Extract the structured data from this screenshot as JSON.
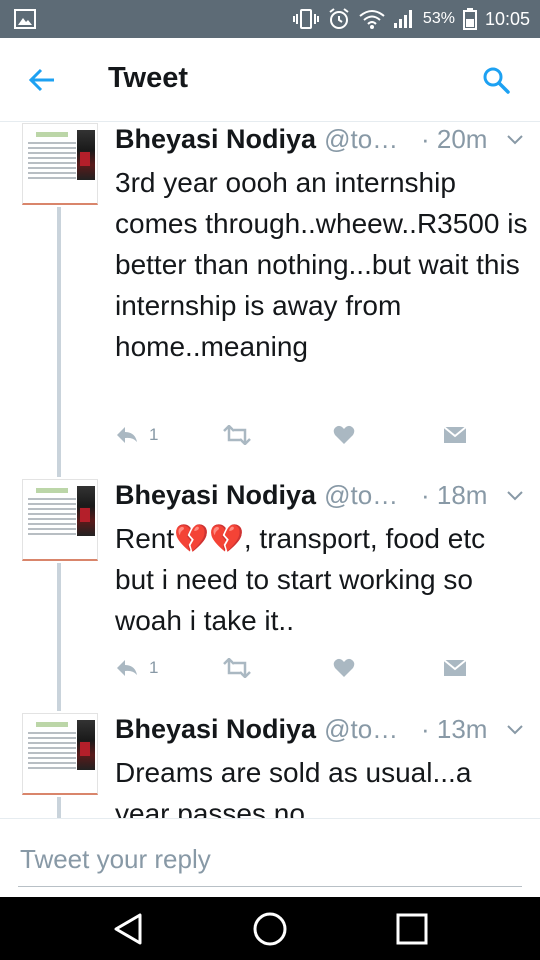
{
  "status_bar": {
    "battery_percent": "53%",
    "time": "10:05",
    "icons": [
      "gallery-icon",
      "vibrate-icon",
      "alarm-icon",
      "wifi-icon",
      "signal-icon",
      "battery-icon"
    ]
  },
  "app_bar": {
    "title": "Tweet",
    "back_icon": "arrow-left-icon",
    "search_icon": "search-icon",
    "accent_color": "#1da1f2"
  },
  "tweets": [
    {
      "name": "Bheyasi Nodiya",
      "handle": "@to…",
      "time": "· 20m",
      "text": "3rd year oooh an internship comes through..wheew..R3500 is better than nothing...but wait this internship is away from home..meaning",
      "reply_count": "1",
      "retweet_count": "",
      "like_count": ""
    },
    {
      "name": "Bheyasi Nodiya",
      "handle": "@to…",
      "time": "· 18m",
      "text": "Rent💔💔, transport, food etc but i need to start working so woah i take it..",
      "reply_count": "1",
      "retweet_count": "",
      "like_count": ""
    },
    {
      "name": "Bheyasi Nodiya",
      "handle": "@to…",
      "time": "· 13m",
      "text": "Dreams are sold as usual...a year passes no",
      "reply_count": "",
      "retweet_count": "",
      "like_count": ""
    }
  ],
  "reply_bar": {
    "placeholder": "Tweet your reply"
  },
  "nav_bar": {
    "icons": [
      "back-triangle-icon",
      "home-circle-icon",
      "recents-square-icon"
    ]
  }
}
